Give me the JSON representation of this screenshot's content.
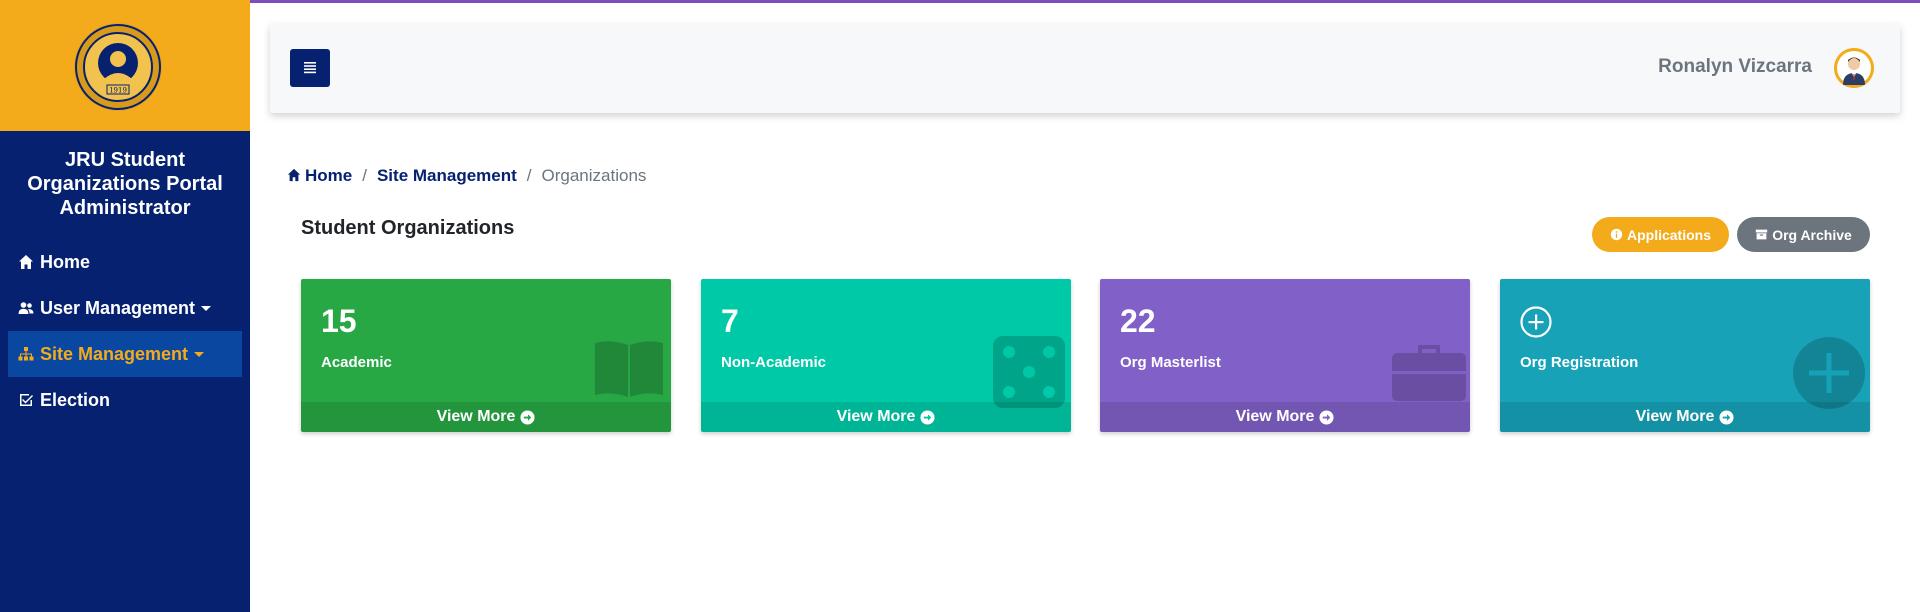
{
  "sidebar": {
    "portal_title": "JRU Student Organizations Portal Administrator",
    "logo_year": "1919",
    "items": [
      {
        "label": "Home",
        "icon": "home-icon"
      },
      {
        "label": "User Management",
        "icon": "users-icon"
      },
      {
        "label": "Site Management",
        "icon": "sitemap-icon"
      },
      {
        "label": "Election",
        "icon": "checkbox-icon"
      }
    ],
    "active_color": "#f4ab1b"
  },
  "header": {
    "username": "Ronalyn Vizcarra"
  },
  "breadcrumb": {
    "home": "Home",
    "site_management": "Site Management",
    "current": "Organizations"
  },
  "page": {
    "title": "Student Organizations",
    "applications_label": "Applications",
    "archive_label": "Org Archive"
  },
  "cards": [
    {
      "count": "15",
      "label": "Academic",
      "footer": "View More",
      "color": "#28a745",
      "icon": "book-icon"
    },
    {
      "count": "7",
      "label": "Non-Academic",
      "footer": "View More",
      "color": "#00c9a7",
      "icon": "dice-icon"
    },
    {
      "count": "22",
      "label": "Org Masterlist",
      "footer": "View More",
      "color": "#8160c7",
      "icon": "briefcase-icon"
    },
    {
      "count": "",
      "label": "Org Registration",
      "footer": "View More",
      "color": "#17a2b8",
      "icon": "plus-circle-icon"
    }
  ],
  "colors": {
    "sidebar_bg": "#052170",
    "logo_bg": "#f4ab1b",
    "accent_purple": "#7c4dbe"
  }
}
